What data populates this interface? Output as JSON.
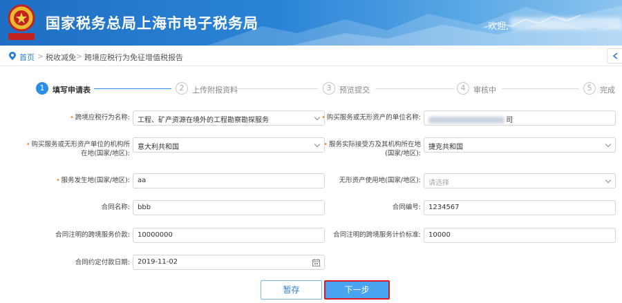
{
  "header": {
    "site_title": "国家税务总局上海市电子税务局",
    "welcome": "欢迎,"
  },
  "breadcrumb": {
    "items": [
      "首页",
      "税收减免",
      "跨境应税行为免征增值税报告"
    ],
    "separator": ">"
  },
  "steps": [
    {
      "num": "1",
      "label": "填写申请表",
      "active": true
    },
    {
      "num": "2",
      "label": "上传附报资料",
      "active": false
    },
    {
      "num": "3",
      "label": "预览提交",
      "active": false
    },
    {
      "num": "4",
      "label": "审核中",
      "active": false
    },
    {
      "num": "5",
      "label": "完成",
      "active": false
    }
  ],
  "form": {
    "cross_border_name": {
      "label": "跨境应税行为名称:",
      "value": "工程、矿产资源在境外的工程勘察勘探服务",
      "required": true
    },
    "buyer_unit_name": {
      "label": "购买服务或无形资产的单位名称:",
      "value_suffix": "司",
      "required": true
    },
    "buyer_location": {
      "label_line1": "购买服务或无形资产单位的机构所",
      "label_line2": "在地(国家/地区):",
      "value": "意大利共和国",
      "required": true
    },
    "receiver_location": {
      "label_line1": "服务实际接受方及其机构所在地",
      "label_line2": "(国家/地区):",
      "value": "捷克共和国",
      "required": true
    },
    "service_location": {
      "label": "服务发生地(国家/地区):",
      "value": "aa",
      "required": true
    },
    "intangible_use_location": {
      "label": "无形资产使用地(国家/地区):",
      "placeholder": "请选择",
      "required": false
    },
    "contract_name": {
      "label": "合同名称:",
      "value": "bbb"
    },
    "contract_no": {
      "label": "合同编号:",
      "value": "1234567"
    },
    "contract_price": {
      "label": "合同注明的跨境服务价款:",
      "value": "10000000"
    },
    "contract_standard": {
      "label": "合同注明的跨境服务计价标准:",
      "value": "10000"
    },
    "payment_date": {
      "label": "合同约定付款日期:",
      "value": "2019-11-02"
    }
  },
  "buttons": {
    "save": "暂存",
    "next": "下一步"
  },
  "colors": {
    "primary": "#2a8ee8",
    "header_blue": "#1f6fc4",
    "required": "#f08a24",
    "highlight_border": "#e0191f"
  }
}
